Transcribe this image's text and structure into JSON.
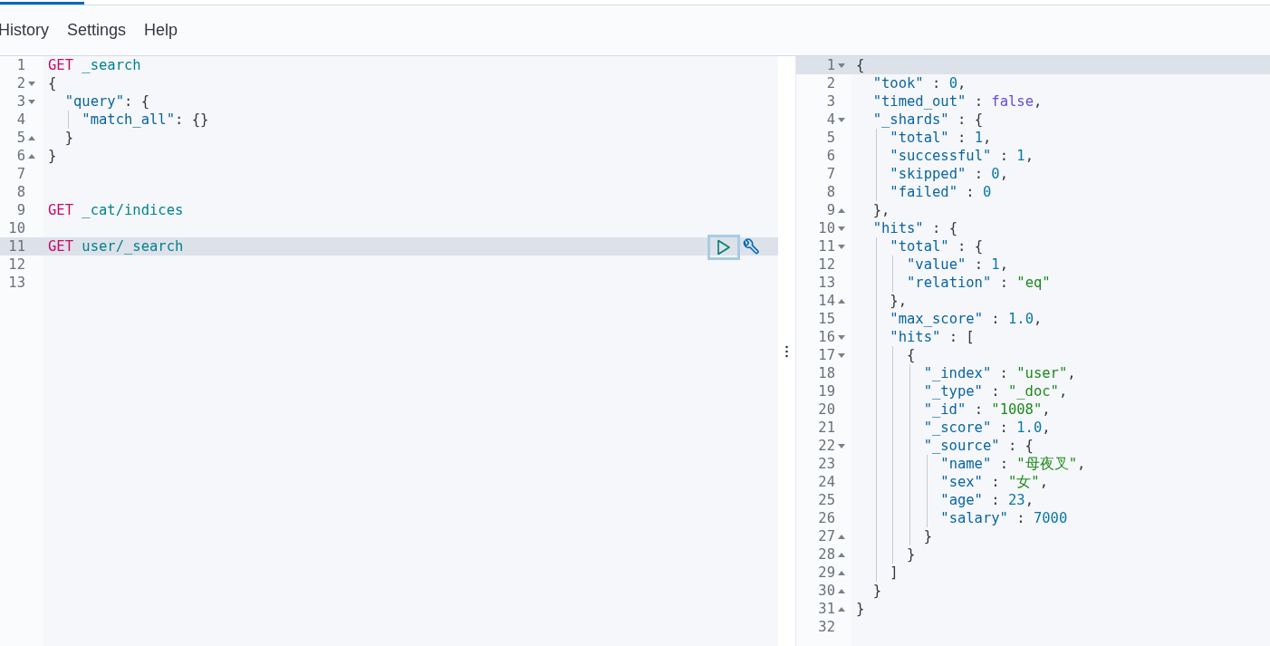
{
  "menu": [
    {
      "label": "History"
    },
    {
      "label": "Settings"
    },
    {
      "label": "Help"
    }
  ],
  "request_editor": {
    "lines": [
      {
        "number": "1",
        "kind": "plain",
        "active": false,
        "tokens": [
          {
            "kind": "method",
            "text": "GET"
          },
          {
            "kind": "path",
            "text": " _search"
          }
        ]
      },
      {
        "number": "2",
        "kind": "fold_start",
        "active": false,
        "tokens": [
          {
            "kind": "punct",
            "text": "{"
          }
        ]
      },
      {
        "number": "3",
        "kind": "fold_start",
        "active": false,
        "tokens": [
          {
            "kind": "key",
            "text": "\"query\""
          },
          {
            "kind": "punct",
            "text": ": {"
          }
        ]
      },
      {
        "number": "4",
        "kind": "plain",
        "active": false,
        "tokens": [
          {
            "kind": "key",
            "text": "\"match_all\""
          },
          {
            "kind": "punct",
            "text": ": {}"
          }
        ]
      },
      {
        "number": "5",
        "kind": "fold_end",
        "active": false,
        "tokens": [
          {
            "kind": "punct",
            "text": "}"
          }
        ]
      },
      {
        "number": "6",
        "kind": "fold_end",
        "active": false,
        "tokens": [
          {
            "kind": "punct",
            "text": "}"
          }
        ]
      },
      {
        "number": "7",
        "kind": "plain",
        "active": false
      },
      {
        "number": "8",
        "kind": "plain",
        "active": false
      },
      {
        "number": "9",
        "kind": "plain",
        "active": false,
        "tokens": [
          {
            "kind": "method",
            "text": "GET"
          },
          {
            "kind": "path",
            "text": " _cat/indices"
          }
        ]
      },
      {
        "number": "10",
        "kind": "plain",
        "active": false
      },
      {
        "number": "11",
        "kind": "plain",
        "active": true,
        "tokens": [
          {
            "kind": "method",
            "text": "GET"
          },
          {
            "kind": "path",
            "text": " user/_search"
          }
        ]
      },
      {
        "number": "12",
        "kind": "plain",
        "active": false
      },
      {
        "number": "13",
        "kind": "plain",
        "active": false
      }
    ]
  },
  "response_viewer": {
    "lines": [
      {
        "number": "1",
        "kind": "fold_start",
        "active": true,
        "tokens": [
          {
            "kind": "punct",
            "text": "{"
          }
        ]
      },
      {
        "number": "2",
        "kind": "plain",
        "active": false,
        "tokens": [
          {
            "kind": "key",
            "text": "\"took\""
          },
          {
            "kind": "punct",
            "text": " : "
          },
          {
            "kind": "number",
            "text": "0"
          },
          {
            "kind": "punct",
            "text": ","
          }
        ]
      },
      {
        "number": "3",
        "kind": "plain",
        "active": false,
        "tokens": [
          {
            "kind": "key",
            "text": "\"timed_out\""
          },
          {
            "kind": "punct",
            "text": " : "
          },
          {
            "kind": "boolean",
            "text": "false"
          },
          {
            "kind": "punct",
            "text": ","
          }
        ]
      },
      {
        "number": "4",
        "kind": "fold_start",
        "active": false,
        "tokens": [
          {
            "kind": "key",
            "text": "\"_shards\""
          },
          {
            "kind": "punct",
            "text": " : {"
          }
        ]
      },
      {
        "number": "5",
        "kind": "plain",
        "active": false,
        "tokens": [
          {
            "kind": "key",
            "text": "\"total\""
          },
          {
            "kind": "punct",
            "text": " : "
          },
          {
            "kind": "number",
            "text": "1"
          },
          {
            "kind": "punct",
            "text": ","
          }
        ]
      },
      {
        "number": "6",
        "kind": "plain",
        "active": false,
        "tokens": [
          {
            "kind": "key",
            "text": "\"successful\""
          },
          {
            "kind": "punct",
            "text": " : "
          },
          {
            "kind": "number",
            "text": "1"
          },
          {
            "kind": "punct",
            "text": ","
          }
        ]
      },
      {
        "number": "7",
        "kind": "plain",
        "active": false,
        "tokens": [
          {
            "kind": "key",
            "text": "\"skipped\""
          },
          {
            "kind": "punct",
            "text": " : "
          },
          {
            "kind": "number",
            "text": "0"
          },
          {
            "kind": "punct",
            "text": ","
          }
        ]
      },
      {
        "number": "8",
        "kind": "plain",
        "active": false,
        "tokens": [
          {
            "kind": "key",
            "text": "\"failed\""
          },
          {
            "kind": "punct",
            "text": " : "
          },
          {
            "kind": "number",
            "text": "0"
          }
        ]
      },
      {
        "number": "9",
        "kind": "fold_end",
        "active": false,
        "tokens": [
          {
            "kind": "punct",
            "text": "},"
          }
        ]
      },
      {
        "number": "10",
        "kind": "fold_start",
        "active": false,
        "tokens": [
          {
            "kind": "key",
            "text": "\"hits\""
          },
          {
            "kind": "punct",
            "text": " : {"
          }
        ]
      },
      {
        "number": "11",
        "kind": "fold_start",
        "active": false,
        "tokens": [
          {
            "kind": "key",
            "text": "\"total\""
          },
          {
            "kind": "punct",
            "text": " : {"
          }
        ]
      },
      {
        "number": "12",
        "kind": "plain",
        "active": false,
        "tokens": [
          {
            "kind": "key",
            "text": "\"value\""
          },
          {
            "kind": "punct",
            "text": " : "
          },
          {
            "kind": "number",
            "text": "1"
          },
          {
            "kind": "punct",
            "text": ","
          }
        ]
      },
      {
        "number": "13",
        "kind": "plain",
        "active": false,
        "tokens": [
          {
            "kind": "key",
            "text": "\"relation\""
          },
          {
            "kind": "punct",
            "text": " : "
          },
          {
            "kind": "string",
            "text": "\"eq\""
          }
        ]
      },
      {
        "number": "14",
        "kind": "fold_end",
        "active": false,
        "tokens": [
          {
            "kind": "punct",
            "text": "},"
          }
        ]
      },
      {
        "number": "15",
        "kind": "plain",
        "active": false,
        "tokens": [
          {
            "kind": "key",
            "text": "\"max_score\""
          },
          {
            "kind": "punct",
            "text": " : "
          },
          {
            "kind": "number",
            "text": "1.0"
          },
          {
            "kind": "punct",
            "text": ","
          }
        ]
      },
      {
        "number": "16",
        "kind": "fold_start",
        "active": false,
        "tokens": [
          {
            "kind": "key",
            "text": "\"hits\""
          },
          {
            "kind": "punct",
            "text": " : ["
          }
        ]
      },
      {
        "number": "17",
        "kind": "fold_start",
        "active": false,
        "tokens": [
          {
            "kind": "punct",
            "text": "{"
          }
        ]
      },
      {
        "number": "18",
        "kind": "plain",
        "active": false,
        "tokens": [
          {
            "kind": "key",
            "text": "\"_index\""
          },
          {
            "kind": "punct",
            "text": " : "
          },
          {
            "kind": "string",
            "text": "\"user\""
          },
          {
            "kind": "punct",
            "text": ","
          }
        ]
      },
      {
        "number": "19",
        "kind": "plain",
        "active": false,
        "tokens": [
          {
            "kind": "key",
            "text": "\"_type\""
          },
          {
            "kind": "punct",
            "text": " : "
          },
          {
            "kind": "string",
            "text": "\"_doc\""
          },
          {
            "kind": "punct",
            "text": ","
          }
        ]
      },
      {
        "number": "20",
        "kind": "plain",
        "active": false,
        "tokens": [
          {
            "kind": "key",
            "text": "\"_id\""
          },
          {
            "kind": "punct",
            "text": " : "
          },
          {
            "kind": "string",
            "text": "\"1008\""
          },
          {
            "kind": "punct",
            "text": ","
          }
        ]
      },
      {
        "number": "21",
        "kind": "plain",
        "active": false,
        "tokens": [
          {
            "kind": "key",
            "text": "\"_score\""
          },
          {
            "kind": "punct",
            "text": " : "
          },
          {
            "kind": "number",
            "text": "1.0"
          },
          {
            "kind": "punct",
            "text": ","
          }
        ]
      },
      {
        "number": "22",
        "kind": "fold_start",
        "active": false,
        "tokens": [
          {
            "kind": "key",
            "text": "\"_source\""
          },
          {
            "kind": "punct",
            "text": " : {"
          }
        ]
      },
      {
        "number": "23",
        "kind": "plain",
        "active": false,
        "tokens": [
          {
            "kind": "key",
            "text": "\"name\""
          },
          {
            "kind": "punct",
            "text": " : "
          },
          {
            "kind": "string",
            "text": "\"母夜叉\""
          },
          {
            "kind": "punct",
            "text": ","
          }
        ]
      },
      {
        "number": "24",
        "kind": "plain",
        "active": false,
        "tokens": [
          {
            "kind": "key",
            "text": "\"sex\""
          },
          {
            "kind": "punct",
            "text": " : "
          },
          {
            "kind": "string",
            "text": "\"女\""
          },
          {
            "kind": "punct",
            "text": ","
          }
        ]
      },
      {
        "number": "25",
        "kind": "plain",
        "active": false,
        "tokens": [
          {
            "kind": "key",
            "text": "\"age\""
          },
          {
            "kind": "punct",
            "text": " : "
          },
          {
            "kind": "number",
            "text": "23"
          },
          {
            "kind": "punct",
            "text": ","
          }
        ]
      },
      {
        "number": "26",
        "kind": "plain",
        "active": false,
        "tokens": [
          {
            "kind": "key",
            "text": "\"salary\""
          },
          {
            "kind": "punct",
            "text": " : "
          },
          {
            "kind": "number",
            "text": "7000"
          }
        ]
      },
      {
        "number": "27",
        "kind": "fold_end",
        "active": false,
        "tokens": [
          {
            "kind": "punct",
            "text": "}"
          }
        ]
      },
      {
        "number": "28",
        "kind": "fold_end",
        "active": false,
        "tokens": [
          {
            "kind": "punct",
            "text": "}"
          }
        ]
      },
      {
        "number": "29",
        "kind": "fold_end",
        "active": false,
        "tokens": [
          {
            "kind": "punct",
            "text": "]"
          }
        ]
      },
      {
        "number": "30",
        "kind": "fold_end",
        "active": false,
        "tokens": [
          {
            "kind": "punct",
            "text": "}"
          }
        ]
      },
      {
        "number": "31",
        "kind": "fold_end",
        "active": false,
        "tokens": [
          {
            "kind": "punct",
            "text": "}"
          }
        ]
      },
      {
        "number": "32",
        "kind": "plain",
        "active": false
      }
    ]
  }
}
